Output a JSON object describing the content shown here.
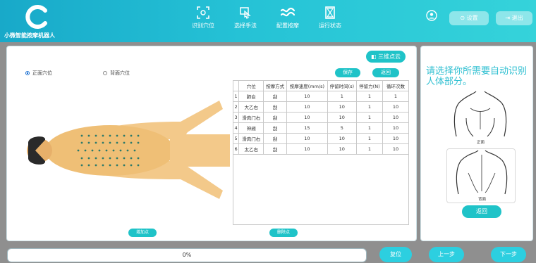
{
  "header": {
    "brand": "小微智能按摩机器人",
    "nav": [
      {
        "label": "识别穴位",
        "icon": "acupoint-scan-icon"
      },
      {
        "label": "选择手法",
        "icon": "hand-touch-icon"
      },
      {
        "label": "配置按摩",
        "icon": "wave-icon"
      },
      {
        "label": "运行状态",
        "icon": "hourglass-icon"
      }
    ],
    "settings_label": "设置",
    "logout_label": "退出"
  },
  "main": {
    "view3d_label": "三维点云",
    "radio_front": "正面穴位",
    "radio_back": "背面穴位",
    "save_label": "保存",
    "return_label": "返回",
    "add_point_label": "增加点",
    "delete_point_label": "删除点",
    "table": {
      "headers": [
        "",
        "穴位",
        "按摩方式",
        "按摩速度(mm/s)",
        "停留时间(s)",
        "停留力(N)",
        "循环次数"
      ],
      "rows": [
        [
          "1",
          "肺俞",
          "刮",
          "10",
          "1",
          "1",
          "1"
        ],
        [
          "2",
          "大乙右",
          "刮",
          "10",
          "10",
          "1",
          "10"
        ],
        [
          "3",
          "滑肉门右",
          "刮",
          "10",
          "10",
          "1",
          "10"
        ],
        [
          "4",
          "神阙",
          "刮",
          "15",
          "5",
          "1",
          "10"
        ],
        [
          "5",
          "滑肉门右",
          "刮",
          "10",
          "10",
          "1",
          "10"
        ],
        [
          "6",
          "太乙右",
          "刮",
          "10",
          "10",
          "1",
          "10"
        ]
      ]
    }
  },
  "right": {
    "title": "请选择你所需要自动识别人体部分。",
    "front_label": "正面",
    "back_label": "背面",
    "return_label": "返回"
  },
  "footer": {
    "progress": "0%",
    "reset_label": "复位",
    "prev_label": "上一步",
    "next_label": "下一步"
  },
  "colors": {
    "accent": "#1fc3c8",
    "title": "#2dbfd1",
    "header_start": "#18a9c9",
    "header_end": "#35d3da"
  }
}
